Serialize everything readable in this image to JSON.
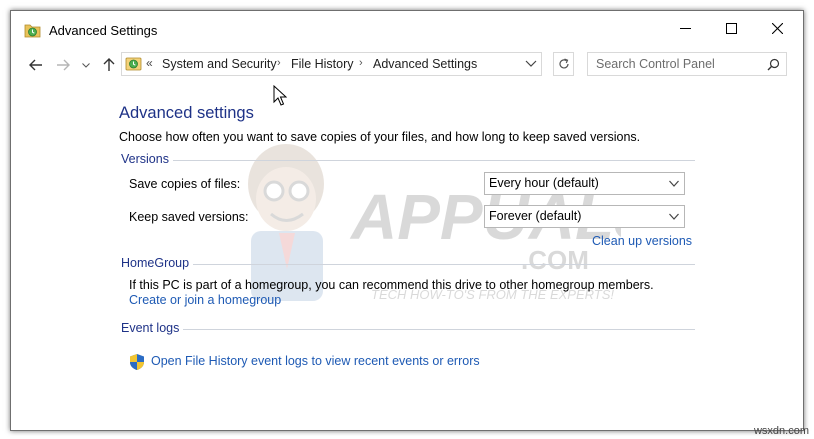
{
  "window": {
    "title": "Advanced Settings"
  },
  "address": {
    "overflow": "«",
    "breadcrumbs": [
      "System and Security",
      "File History",
      "Advanced Settings"
    ]
  },
  "search": {
    "placeholder": "Search Control Panel"
  },
  "main": {
    "title": "Advanced settings",
    "description": "Choose how often you want to save copies of your files, and how long to keep saved versions.",
    "versions": {
      "heading": "Versions",
      "save_copies_label": "Save copies of files:",
      "save_copies_value": "Every hour (default)",
      "keep_versions_label": "Keep saved versions:",
      "keep_versions_value": "Forever (default)",
      "cleanup_link": "Clean up versions"
    },
    "homegroup": {
      "heading": "HomeGroup",
      "text": "If this PC is part of a homegroup, you can recommend this drive to other homegroup members.",
      "link": "Create or join a homegroup"
    },
    "eventlogs": {
      "heading": "Event logs",
      "link": "Open File History event logs to view recent events or errors"
    }
  },
  "watermark": {
    "brand": "APPUALS",
    "domain": ".COM",
    "tagline": "TECH HOW-TO'S FROM THE EXPERTS!"
  },
  "corner_mark": "wsxdn.com",
  "colors": {
    "heading_blue": "#1e3287",
    "link_blue": "#1e5ab4",
    "group_line": "#cfd4dc"
  }
}
